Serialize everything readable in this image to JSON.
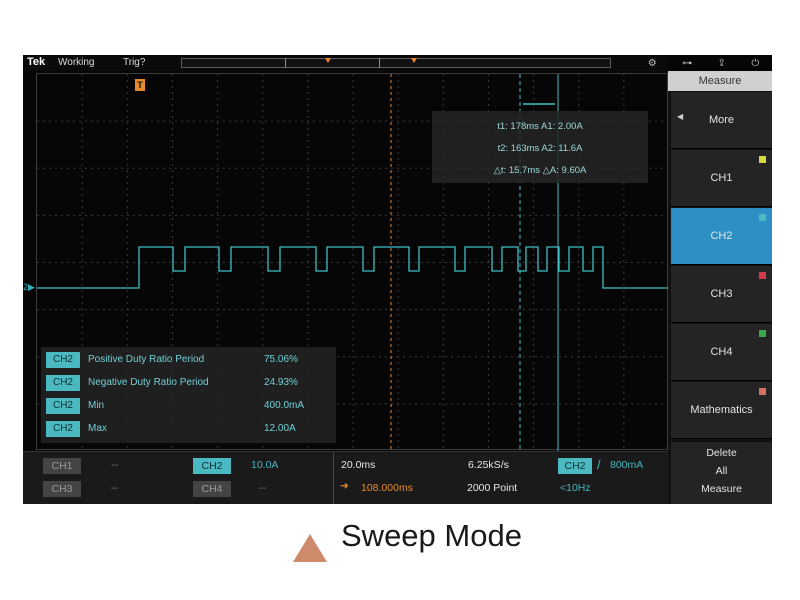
{
  "topbar": {
    "brand": "Tek",
    "status": "Working",
    "trigger": "Trig?",
    "icons": [
      "gear-icon",
      "network-icon",
      "usb-icon",
      "power-icon"
    ]
  },
  "markers": {
    "trigger_marker": "T",
    "channel_marker": "2▶"
  },
  "cursor_readout": {
    "line1": "t1: 178ms  A1: 2.00A",
    "line2": "t2: 163ms  A2: 11.6A",
    "line3": "△t: 15.7ms  △A: 9.60A"
  },
  "measurements": [
    {
      "channel": "CH2",
      "name": "Positive Duty Ratio Period",
      "value": "75.06%"
    },
    {
      "channel": "CH2",
      "name": "Negative Duty Ratio Period",
      "value": "24.93%"
    },
    {
      "channel": "CH2",
      "name": "Min",
      "value": "400.0mA"
    },
    {
      "channel": "CH2",
      "name": "Max",
      "value": "12.00A"
    }
  ],
  "channels": {
    "ch1": {
      "label": "CH1",
      "value": "--"
    },
    "ch2": {
      "label": "CH2",
      "value": "10.0A"
    },
    "ch3": {
      "label": "CH3",
      "value": "--"
    },
    "ch4": {
      "label": "CH4",
      "value": "--"
    }
  },
  "timebase": {
    "scale": "20.0ms",
    "sample_rate": "6.25kS/s",
    "position": "108.000ms",
    "record_length": "2000 Point"
  },
  "trigger": {
    "source": "CH2",
    "slope": "/",
    "level": "800mA",
    "frequency": "<10Hz"
  },
  "menu": {
    "title": "Measure",
    "items": [
      {
        "label": "More"
      },
      {
        "label": "CH1",
        "color": "#d8d840"
      },
      {
        "label": "CH2",
        "color": "#4bb9c2"
      },
      {
        "label": "CH3",
        "color": "#d23a4a"
      },
      {
        "label": "CH4",
        "color": "#3aa84a"
      },
      {
        "label": "Mathematics",
        "color": "#d87060"
      }
    ],
    "delete_line1": "Delete",
    "delete_line2": "All",
    "delete_line3": "Measure"
  },
  "caption": {
    "text": "Sweep Mode"
  },
  "colors": {
    "trace": "#3fbfc6",
    "trigger": "#e8862a",
    "active_menu": "#2d8fc4"
  }
}
